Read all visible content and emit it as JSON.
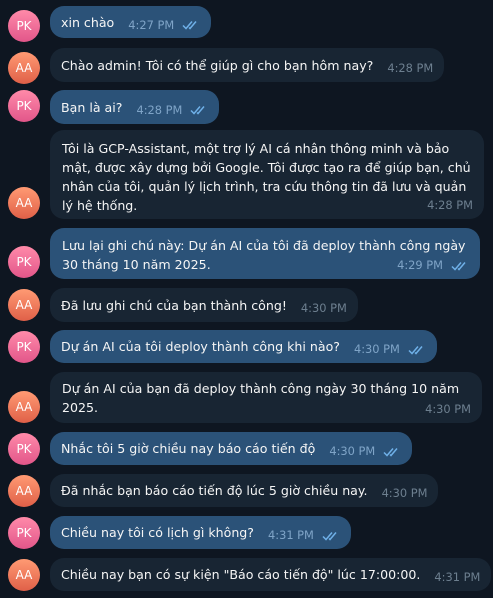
{
  "chat": {
    "messages": [
      {
        "avatar": "PK",
        "text": "xin chào",
        "time": "4:27 PM",
        "outgoing": true
      },
      {
        "avatar": "AA",
        "text": "Chào admin! Tôi có thể giúp gì cho bạn hôm nay?",
        "time": "4:28 PM",
        "outgoing": false
      },
      {
        "avatar": "PK",
        "text": "Bạn là ai?",
        "time": "4:28 PM",
        "outgoing": true
      },
      {
        "avatar": "AA",
        "text": "Tôi là GCP-Assistant, một trợ lý AI cá nhân thông minh và bảo mật, được xây dựng bởi Google. Tôi được tạo ra để giúp bạn, chủ nhân của tôi, quản lý lịch trình, tra cứu thông tin đã lưu và quản lý hệ thống.",
        "time": "4:28 PM",
        "outgoing": false
      },
      {
        "avatar": "PK",
        "text": "Lưu lại ghi chú này: Dự án AI của tôi đã deploy thành công ngày 30 tháng 10 năm 2025.",
        "time": "4:29 PM",
        "outgoing": true
      },
      {
        "avatar": "AA",
        "text": "Đã lưu ghi chú của bạn thành công!",
        "time": "4:30 PM",
        "outgoing": false
      },
      {
        "avatar": "PK",
        "text": "Dự án AI của tôi deploy thành công khi nào?",
        "time": "4:30 PM",
        "outgoing": true
      },
      {
        "avatar": "AA",
        "text": "Dự án AI của bạn đã deploy thành công ngày 30 tháng 10 năm 2025.",
        "time": "4:30 PM",
        "outgoing": false
      },
      {
        "avatar": "PK",
        "text": "Nhắc tôi 5 giờ chiều nay báo cáo tiến độ",
        "time": "4:30 PM",
        "outgoing": true
      },
      {
        "avatar": "AA",
        "text": "Đã nhắc bạn báo cáo tiến độ lúc 5 giờ chiều nay.",
        "time": "4:30 PM",
        "outgoing": false
      },
      {
        "avatar": "PK",
        "text": "Chiều nay tôi có lịch gì không?",
        "time": "4:31 PM",
        "outgoing": true
      },
      {
        "avatar": "AA",
        "text": "Chiều nay bạn có sự kiện \"Báo cáo tiến độ\" lúc 17:00:00.",
        "time": "4:31 PM",
        "outgoing": false
      }
    ]
  },
  "colors": {
    "background": "#0e1621",
    "bubble_outgoing": "#2b5278",
    "bubble_incoming": "#182533",
    "read_ticks": "#6fb0e8"
  },
  "icons": {
    "read_receipt": "double-check-icon"
  }
}
